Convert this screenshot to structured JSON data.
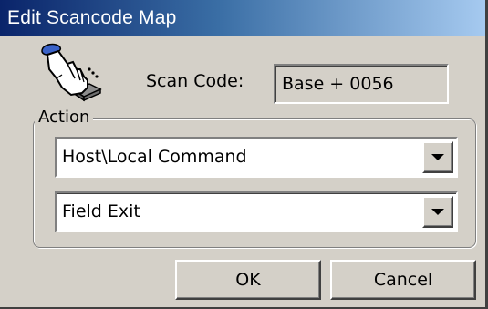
{
  "window": {
    "title": "Edit Scancode Map"
  },
  "scan": {
    "label": "Scan Code:",
    "value": "Base + 0056"
  },
  "action": {
    "legend": "Action",
    "category_selected": "Host\\Local Command",
    "command_selected": "Field Exit"
  },
  "buttons": {
    "ok": "OK",
    "cancel": "Cancel"
  },
  "icons": {
    "header": "hand-pressing-key-icon",
    "dropdown": "chevron-down-icon"
  },
  "colors": {
    "title_start": "#0a246a",
    "title_end": "#a6caf0",
    "face": "#d4d0c8",
    "field_bg": "#ffffff"
  }
}
